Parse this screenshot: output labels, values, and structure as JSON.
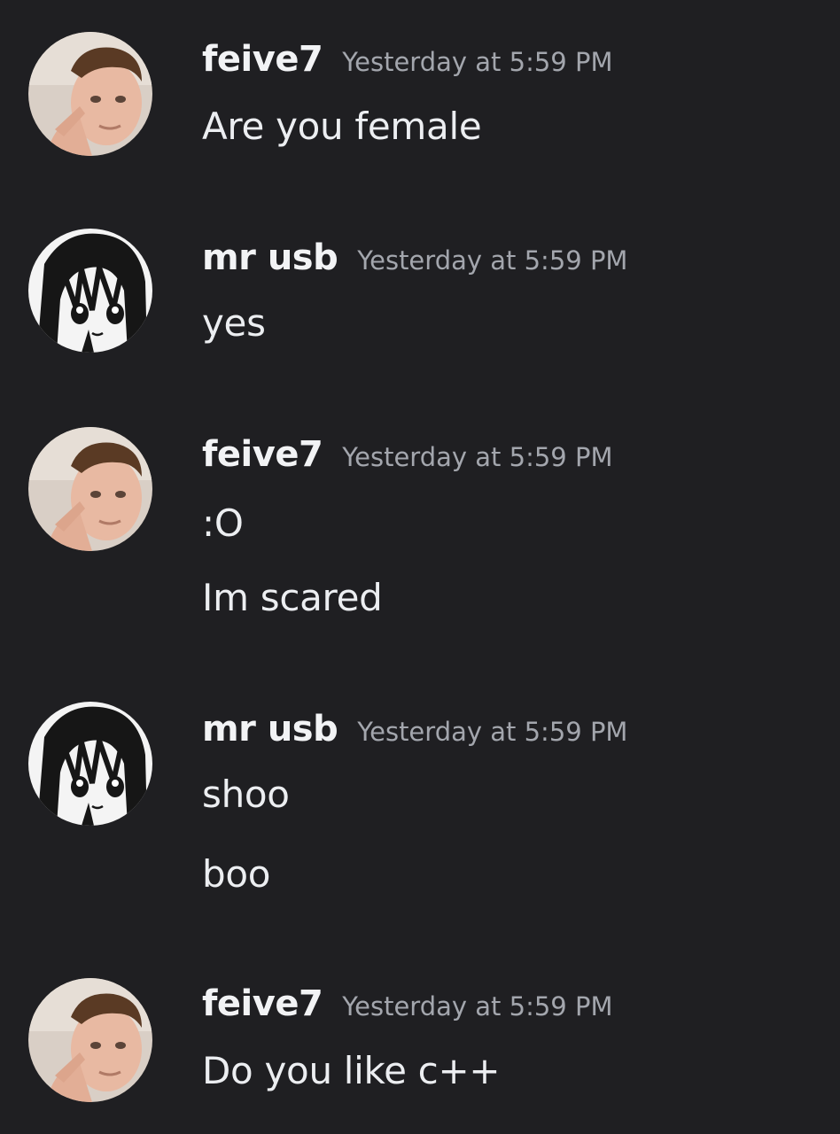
{
  "messages": [
    {
      "avatar": "photo-avatar",
      "username": "feive7",
      "timestamp": "Yesterday at 5:59 PM",
      "lines": [
        "Are you female"
      ]
    },
    {
      "avatar": "anime-avatar",
      "username": "mr usb",
      "timestamp": "Yesterday at 5:59 PM",
      "lines": [
        "yes"
      ]
    },
    {
      "avatar": "photo-avatar",
      "username": "feive7",
      "timestamp": "Yesterday at 5:59 PM",
      "lines": [
        ":O",
        "Im scared"
      ]
    },
    {
      "avatar": "anime-avatar",
      "username": "mr usb",
      "timestamp": "Yesterday at 5:59 PM",
      "lines": [
        "shoo",
        "boo"
      ]
    },
    {
      "avatar": "photo-avatar",
      "username": "feive7",
      "timestamp": "Yesterday at 5:59 PM",
      "lines": [
        "Do you like c++"
      ]
    }
  ],
  "colors": {
    "background": "#1f1f22",
    "username": "#f2f3f5",
    "timestamp": "#a3a6ad",
    "message_text": "#eceef1"
  }
}
